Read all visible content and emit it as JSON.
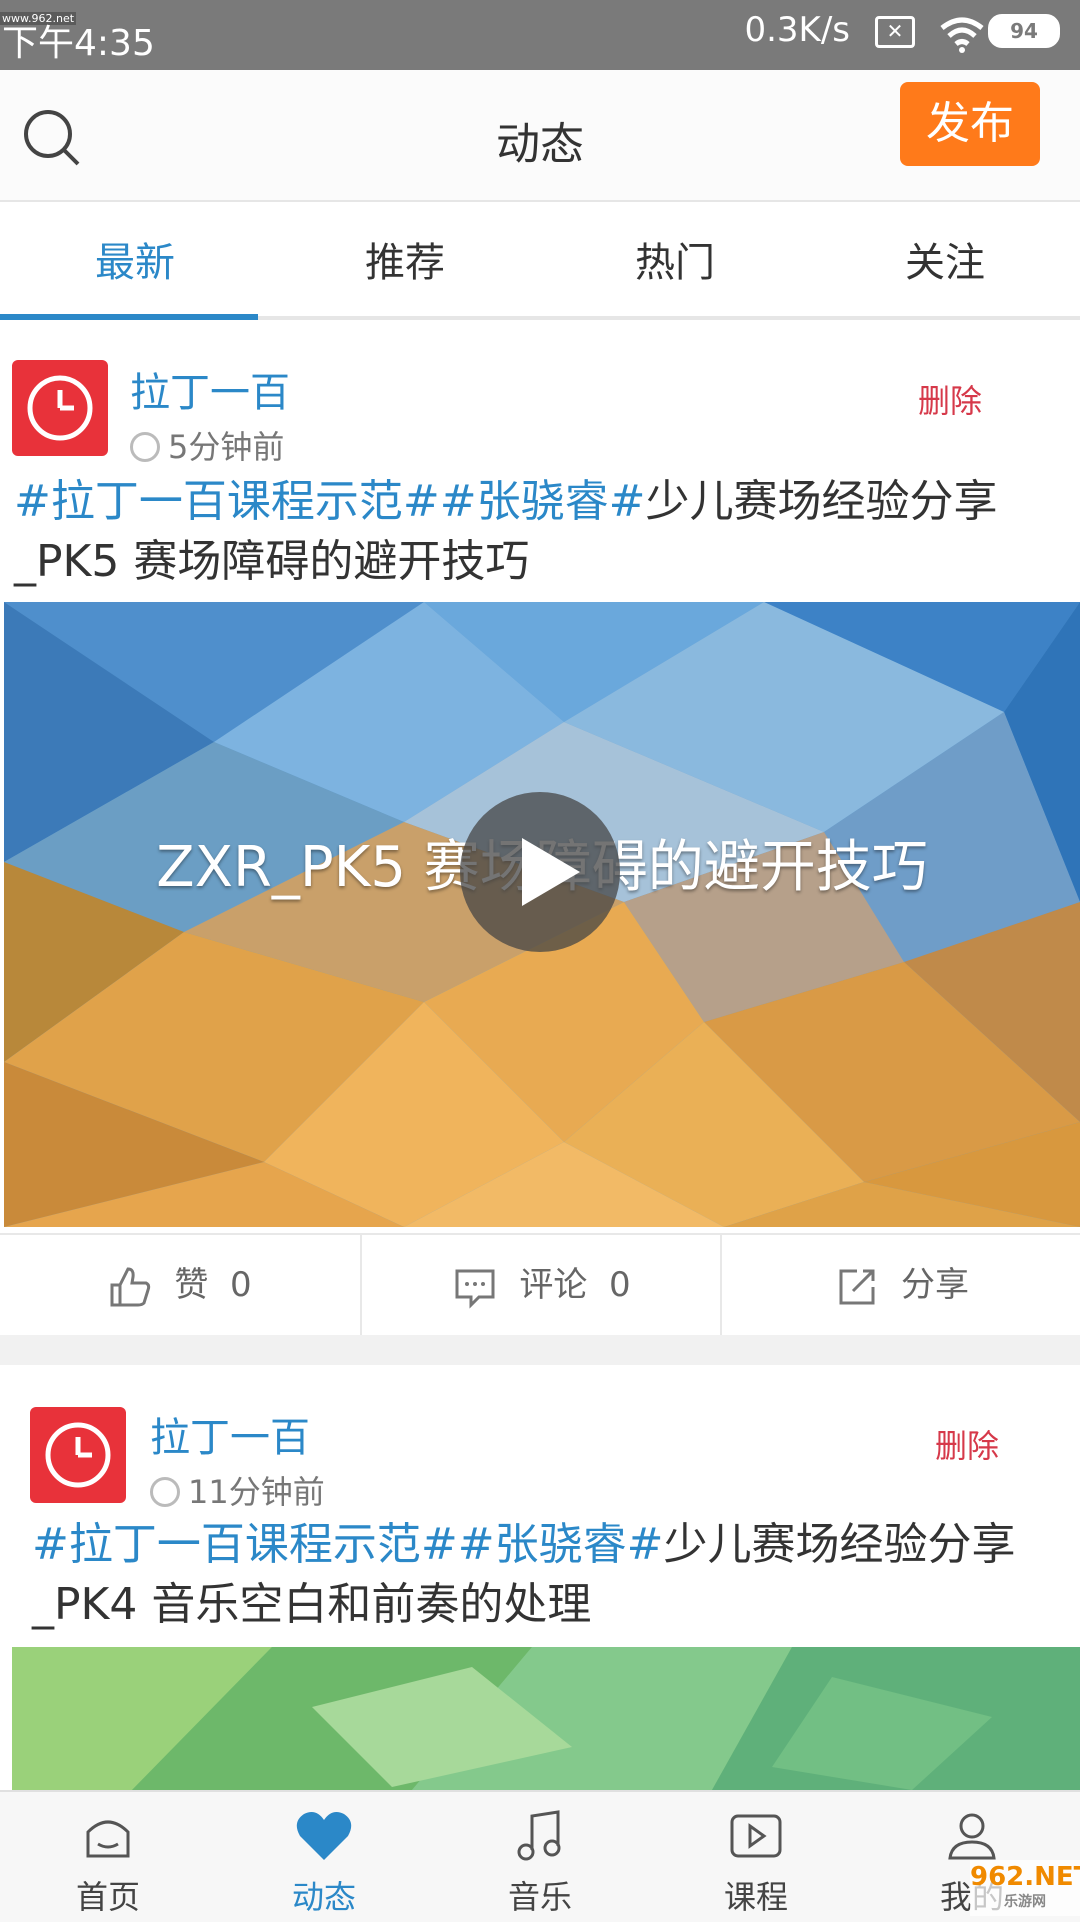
{
  "status": {
    "time": "下午4:35",
    "watermark": "www.962.net",
    "network_speed": "0.3K/s",
    "battery": "94"
  },
  "header": {
    "title": "动态",
    "publish_label": "发布"
  },
  "tabs": [
    {
      "label": "最新",
      "active": true
    },
    {
      "label": "推荐",
      "active": false
    },
    {
      "label": "热门",
      "active": false
    },
    {
      "label": "关注",
      "active": false
    }
  ],
  "posts": [
    {
      "author": "拉丁一百",
      "time_ago": "5分钟前",
      "delete_label": "删除",
      "tags": "#拉丁一百课程示范##张骁睿#",
      "text_line1_rest": "少儿赛场经验分享",
      "text_line2": "_PK5 赛场障碍的避开技巧",
      "video_title": "ZXR_PK5 赛场障碍的避开技巧",
      "likes_label": "赞",
      "likes": "0",
      "comments_label": "评论",
      "comments": "0",
      "share_label": "分享"
    },
    {
      "author": "拉丁一百",
      "time_ago": "11分钟前",
      "delete_label": "删除",
      "tags": "#拉丁一百课程示范##张骁睿#",
      "text_line1_rest": "少儿赛场经验分享",
      "text_line2": "_PK4 音乐空白和前奏的处理"
    }
  ],
  "bottom_nav": [
    {
      "label": "首页",
      "icon": "home-icon",
      "active": false
    },
    {
      "label": "动态",
      "icon": "heart-icon",
      "active": true
    },
    {
      "label": "音乐",
      "icon": "music-note-icon",
      "active": false
    },
    {
      "label": "课程",
      "icon": "video-play-icon",
      "active": false
    },
    {
      "label": "我的",
      "icon": "person-icon",
      "active": false
    }
  ],
  "branding": {
    "logo": "962.NET",
    "sub": "乐游网"
  },
  "colors": {
    "accent": "#2b88c8",
    "publish": "#ff7a1a",
    "delete": "#d6394a",
    "avatar": "#e8323a"
  }
}
